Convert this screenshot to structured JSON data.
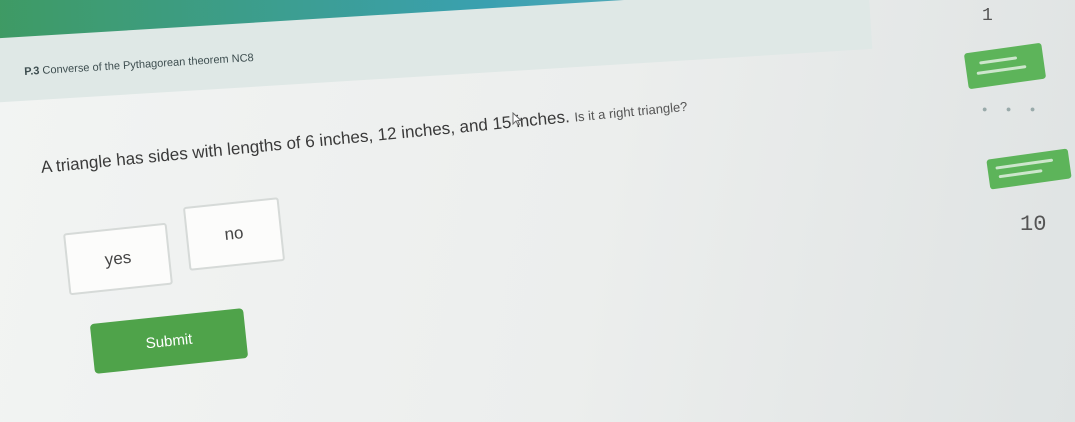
{
  "header": {
    "skill_code": "P.3",
    "skill_name": "Converse of the Pythagorean theorem",
    "skill_id": "NC8"
  },
  "question": {
    "main": "A triangle has sides with lengths of 6 inches, 12 inches, and 15 inches.",
    "sub": "Is it a right triangle?"
  },
  "answers": {
    "yes_label": "yes",
    "no_label": "no"
  },
  "actions": {
    "submit_label": "Submit"
  },
  "sidebar": {
    "top_number": "1",
    "bottom_number": "10"
  },
  "colors": {
    "accent_green": "#4fa34a",
    "topbar_teal": "#3aa0b0"
  }
}
